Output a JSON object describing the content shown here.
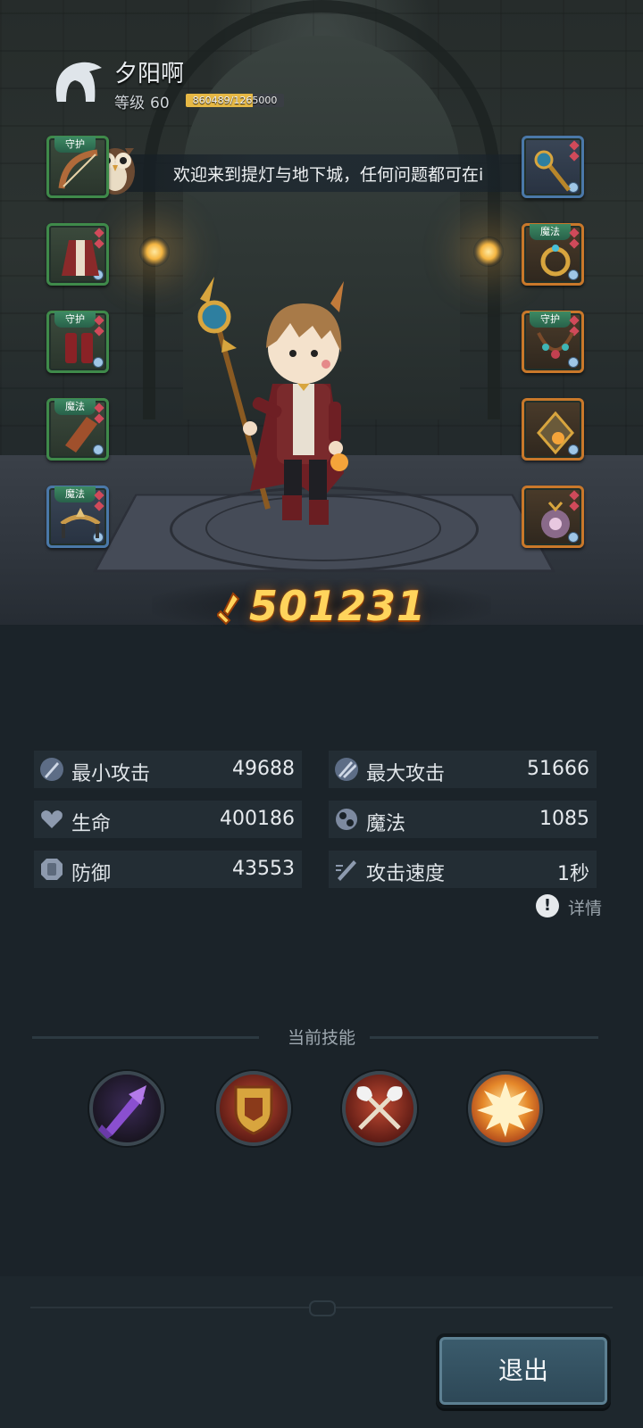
{
  "player": {
    "name": "夕阳啊",
    "level_label": "等级",
    "level": "60",
    "xp_text": "860489/1265000",
    "xp_fraction": 0.68
  },
  "welcome_text": "欢迎来到提灯与地下城，任何问题都可在i",
  "slots": {
    "left": [
      {
        "tag": "守护",
        "icon": "bow-icon",
        "frame": "green"
      },
      {
        "tag": "",
        "icon": "robe-icon",
        "frame": "green"
      },
      {
        "tag": "守护",
        "icon": "boots-icon",
        "frame": "green"
      },
      {
        "tag": "魔法",
        "icon": "bracer-icon",
        "frame": "green"
      },
      {
        "tag": "魔法",
        "icon": "circlet-icon",
        "frame": "blue"
      }
    ],
    "right": [
      {
        "tag": "",
        "icon": "staff-icon",
        "frame": "blue"
      },
      {
        "tag": "魔法",
        "icon": "ring-icon",
        "frame": "orange"
      },
      {
        "tag": "守护",
        "icon": "necklace-icon",
        "frame": "orange"
      },
      {
        "tag": "",
        "icon": "amulet-icon",
        "frame": "orange"
      },
      {
        "tag": "",
        "icon": "charm-icon",
        "frame": "orange"
      }
    ]
  },
  "power": "501231",
  "stats": [
    {
      "label": "最小攻击",
      "value": "49688",
      "icon": "min-attack-icon"
    },
    {
      "label": "最大攻击",
      "value": "51666",
      "icon": "max-attack-icon"
    },
    {
      "label": "生命",
      "value": "400186",
      "icon": "heart-icon"
    },
    {
      "label": "魔法",
      "value": "1085",
      "icon": "magic-icon"
    },
    {
      "label": "防御",
      "value": "43553",
      "icon": "shield-icon"
    },
    {
      "label": "攻击速度",
      "value": "1秒",
      "icon": "speed-icon"
    }
  ],
  "details_label": "详情",
  "skills_title": "当前技能",
  "skills": [
    {
      "icon": "purple-sword-skill-icon",
      "color": "#8a4fd0"
    },
    {
      "icon": "helmet-shield-skill-icon",
      "color": "#b0382c"
    },
    {
      "icon": "crossed-axes-skill-icon",
      "color": "#c04a2a"
    },
    {
      "icon": "explosion-skill-icon",
      "color": "#e5882a"
    }
  ],
  "exit_label": "退出",
  "colors": {
    "background": "#1b2329",
    "power": "#ffd45c",
    "xp_fill": "#e6b845",
    "button": "#3b5c6d"
  }
}
